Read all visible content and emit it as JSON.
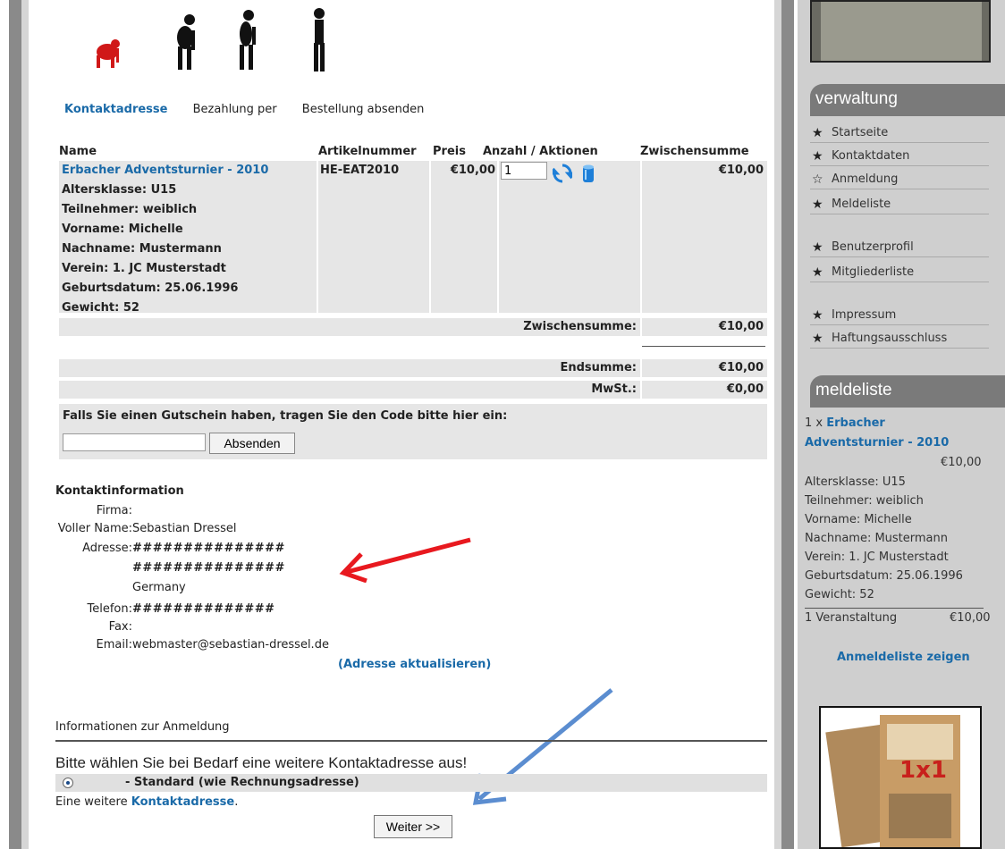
{
  "steps": [
    "Kontaktadresse",
    "Bezahlung per",
    "Bestellung absenden"
  ],
  "cart": {
    "headers": [
      "Name",
      "Artikelnummer",
      "Preis",
      "Anzahl / Aktionen",
      "Zwischensumme"
    ],
    "product_title": "Erbacher Adventsturnier - 2010",
    "attributes": [
      "Altersklasse: U15",
      "Teilnehmer: weiblich",
      "Vorname: Michelle",
      "Nachname: Mustermann",
      "Verein: 1. JC Musterstadt",
      "Geburtsdatum: 25.06.1996",
      "Gewicht: 52"
    ],
    "sku": "HE-EAT2010",
    "price": "€10,00",
    "quantity": "1",
    "row_sum": "€10,00",
    "subtotal_label": "Zwischensumme:",
    "subtotal": "€10,00",
    "total_label": "Endsumme:",
    "total": "€10,00",
    "vat_label": "MwSt.:",
    "vat": "€0,00"
  },
  "coupon": {
    "label": "Falls Sie einen Gutschein haben, tragen Sie den Code bitte hier ein:",
    "button": "Absenden",
    "value": ""
  },
  "contact": {
    "heading": "Kontaktinformation",
    "firma_label": "Firma:",
    "name_label": "Voller Name:",
    "name": "Sebastian Dressel",
    "address_label": "Adresse:",
    "address1": "###############",
    "address2": "###############",
    "country": "Germany",
    "phone_label": "Telefon:",
    "phone": "##############",
    "fax_label": "Fax:",
    "email_label": "Email:",
    "email": "webmaster@sebastian-dressel.de",
    "update_link": "(Adresse aktualisieren)"
  },
  "info": {
    "title": "Informationen zur Anmeldung",
    "choose_text": "Bitte wählen Sie bei Bedarf eine weitere Kontaktadresse aus!",
    "standard_label": "- Standard (wie Rechnungsadresse)",
    "another_prefix": "Eine weitere ",
    "another_link": "Kontaktadresse",
    "another_suffix": ".",
    "next_button": "Weiter >>"
  },
  "sidebar": {
    "verwaltung_title": "verwaltung",
    "menu": [
      "Startseite",
      "Kontaktdaten",
      "Anmeldung",
      "Meldeliste",
      "Benutzerprofil",
      "Mitgliederliste",
      "Impressum",
      "Haftungsausschluss"
    ],
    "meldeliste_title": "meldeliste",
    "ml_qty": "1 x",
    "ml_event_line1": "Erbacher",
    "ml_event_line2": "Adventsturnier - 2010",
    "ml_price": "€10,00",
    "ml_attributes": [
      "Altersklasse: U15",
      "Teilnehmer: weiblich",
      "Vorname: Michelle",
      "Nachname: Mustermann",
      "Verein: 1. JC Musterstadt",
      "Geburtsdatum: 25.06.1996",
      "Gewicht: 52"
    ],
    "ml_count": "1 Veranstaltung",
    "ml_total": "€10,00",
    "ml_link": "Anmeldeliste zeigen",
    "promo_text": "1x1"
  }
}
